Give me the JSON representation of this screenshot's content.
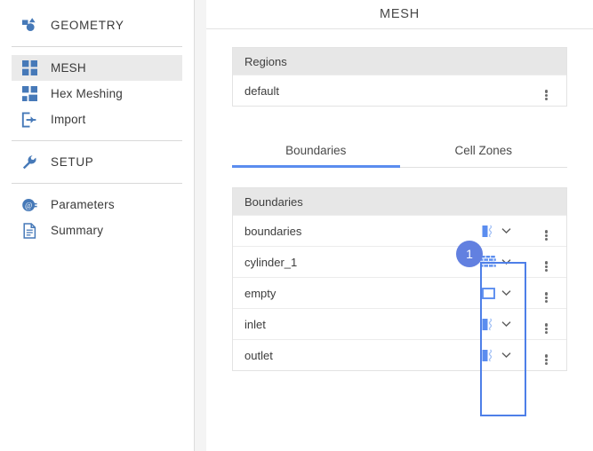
{
  "sidebar": {
    "groups": [
      {
        "items": [
          {
            "label": "GEOMETRY",
            "icon": "geometry-icon",
            "type": "section",
            "selected": false
          }
        ]
      },
      {
        "items": [
          {
            "label": "MESH",
            "icon": "mesh-grid-icon",
            "type": "item",
            "selected": true
          },
          {
            "label": "Hex Meshing",
            "icon": "hex-mesh-icon",
            "type": "item",
            "selected": false
          },
          {
            "label": "Import",
            "icon": "import-icon",
            "type": "item",
            "selected": false
          }
        ]
      },
      {
        "items": [
          {
            "label": "SETUP",
            "icon": "wrench-icon",
            "type": "section",
            "selected": false
          }
        ]
      },
      {
        "items": [
          {
            "label": "Parameters",
            "icon": "parameters-icon",
            "type": "item",
            "selected": false
          },
          {
            "label": "Summary",
            "icon": "summary-document-icon",
            "type": "item",
            "selected": false
          }
        ]
      }
    ]
  },
  "header": {
    "title": "MESH"
  },
  "regions": {
    "header": "Regions",
    "rows": [
      {
        "name": "default",
        "menu": "kebab-menu-icon"
      }
    ]
  },
  "tabs": [
    {
      "label": "Boundaries",
      "active": true
    },
    {
      "label": "Cell Zones",
      "active": false
    }
  ],
  "boundaries": {
    "header": "Boundaries",
    "rows": [
      {
        "name": "boundaries",
        "type_icon": "patch-icon",
        "chevron": "chevron-down-icon",
        "menu": "kebab-menu-icon"
      },
      {
        "name": "cylinder_1",
        "type_icon": "wall-brick-icon",
        "chevron": "chevron-down-icon",
        "menu": "kebab-menu-icon"
      },
      {
        "name": "empty",
        "type_icon": "empty-square-icon",
        "chevron": "chevron-down-icon",
        "menu": "kebab-menu-icon"
      },
      {
        "name": "inlet",
        "type_icon": "patch-icon",
        "chevron": "chevron-down-icon",
        "menu": "kebab-menu-icon"
      },
      {
        "name": "outlet",
        "type_icon": "patch-icon",
        "chevron": "chevron-down-icon",
        "menu": "kebab-menu-icon"
      }
    ]
  },
  "annotation": {
    "badge_label": "1"
  },
  "colors": {
    "accent_blue": "#5b8def",
    "icon_blue": "#4679b8",
    "badge_blue": "#6280e0",
    "highlight_border": "#4e7fe8",
    "header_gray": "#e7e7e7",
    "selected_gray": "#eaeaea"
  }
}
